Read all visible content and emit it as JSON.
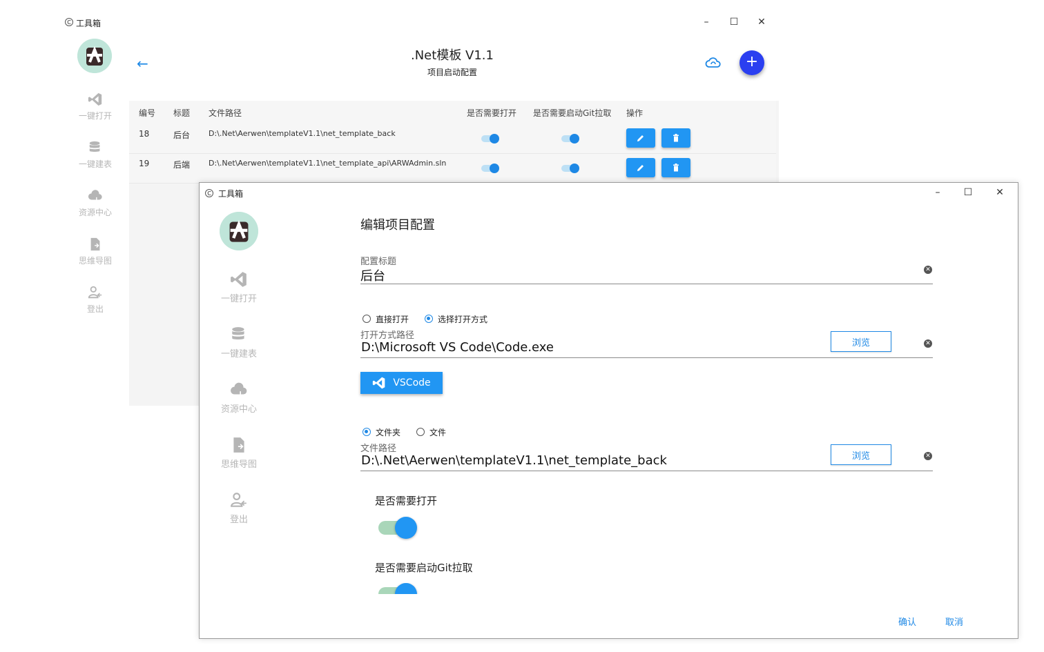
{
  "bg_window": {
    "app_title": "工具箱",
    "page_title": ".Net模板 V1.1",
    "page_subtitle": "项目启动配置",
    "sidebar": [
      {
        "label": "一键打开",
        "icon": "vscode-icon"
      },
      {
        "label": "一键建表",
        "icon": "database-icon"
      },
      {
        "label": "资源中心",
        "icon": "cloud-download-icon"
      },
      {
        "label": "思维导图",
        "icon": "mindmap-file-icon"
      },
      {
        "label": "登出",
        "icon": "logout-icon"
      }
    ],
    "table": {
      "headers": [
        "编号",
        "标题",
        "文件路径",
        "是否需要打开",
        "是否需要启动Git拉取",
        "操作"
      ],
      "rows": [
        {
          "id": "18",
          "title": "后台",
          "path": "D:\\.Net\\Aerwen\\templateV1.1\\net_template_back",
          "open": true,
          "git": true
        },
        {
          "id": "19",
          "title": "后端",
          "path": "D:\\.Net\\Aerwen\\templateV1.1\\net_template_api\\ARWAdmin.sln",
          "open": true,
          "git": true
        }
      ]
    }
  },
  "dialog": {
    "app_title": "工具箱",
    "heading": "编辑项目配置",
    "sidebar": [
      {
        "label": "一键打开",
        "icon": "vscode-icon"
      },
      {
        "label": "一键建表",
        "icon": "database-icon"
      },
      {
        "label": "资源中心",
        "icon": "cloud-download-icon"
      },
      {
        "label": "思维导图",
        "icon": "mindmap-file-icon"
      },
      {
        "label": "登出",
        "icon": "logout-icon"
      }
    ],
    "config_title_label": "配置标题",
    "config_title_value": "后台",
    "open_mode_options": [
      "直接打开",
      "选择打开方式"
    ],
    "open_mode_selected": "选择打开方式",
    "open_path_label": "打开方式路径",
    "open_path_value": "D:\\Microsoft VS Code\\Code.exe",
    "browse_label": "浏览",
    "app_button_label": "VSCode",
    "path_type_options": [
      "文件夹",
      "文件"
    ],
    "path_type_selected": "文件夹",
    "file_path_label": "文件路径",
    "file_path_value": "D:\\.Net\\Aerwen\\templateV1.1\\net_template_back",
    "need_open_label": "是否需要打开",
    "need_open": true,
    "need_git_label": "是否需要启动Git拉取",
    "need_git": true,
    "confirm_label": "确认",
    "cancel_label": "取消"
  },
  "colors": {
    "accent": "#2196f3",
    "fab": "#2b3ff0",
    "switch_track": "#a9d6b9"
  }
}
